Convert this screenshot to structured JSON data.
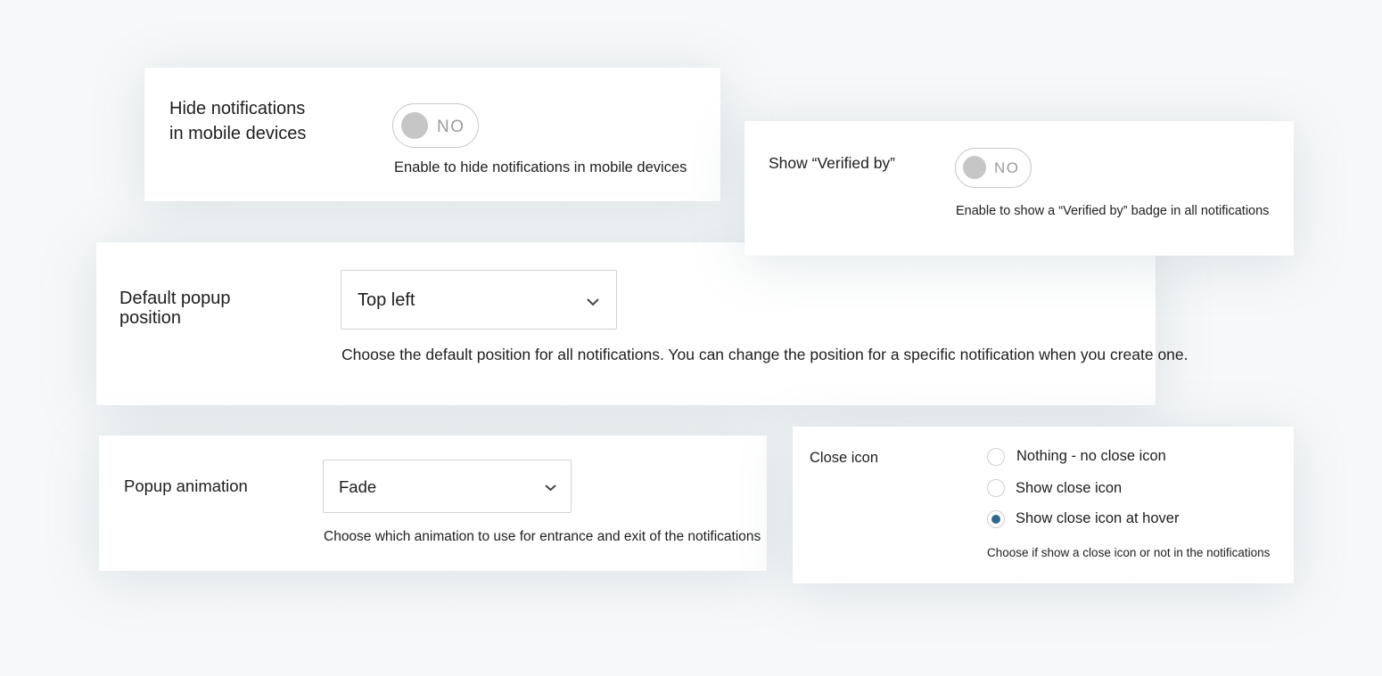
{
  "hide_mobile": {
    "label_line1": "Hide notifications",
    "label_line2": "in mobile devices",
    "toggle_state": "NO",
    "enabled": false,
    "help": "Enable to hide notifications in mobile devices"
  },
  "verified_by": {
    "label": "Show “Verified by”",
    "toggle_state": "NO",
    "enabled": false,
    "help": "Enable to show a “Verified by” badge in all notifications"
  },
  "popup_position": {
    "label_line1": "Default popup",
    "label_line2": "position",
    "selected": "Top left",
    "help": "Choose the default position for all notifications. You can change the position for a specific notification when you create one."
  },
  "popup_animation": {
    "label": "Popup animation",
    "selected": "Fade",
    "help": "Choose which animation to use for entrance and exit of the notifications"
  },
  "close_icon": {
    "label": "Close icon",
    "options": [
      {
        "label": "Nothing - no close icon",
        "checked": false
      },
      {
        "label": "Show close icon",
        "checked": false
      },
      {
        "label": "Show close icon at hover",
        "checked": true
      }
    ],
    "help": "Choose if show a close icon or not in the notifications"
  },
  "colors": {
    "radio_checked": "#2e6b8e",
    "toggle_off": "#c6c6c6"
  },
  "icons": {
    "select_chevron": "chevron-down-icon"
  }
}
